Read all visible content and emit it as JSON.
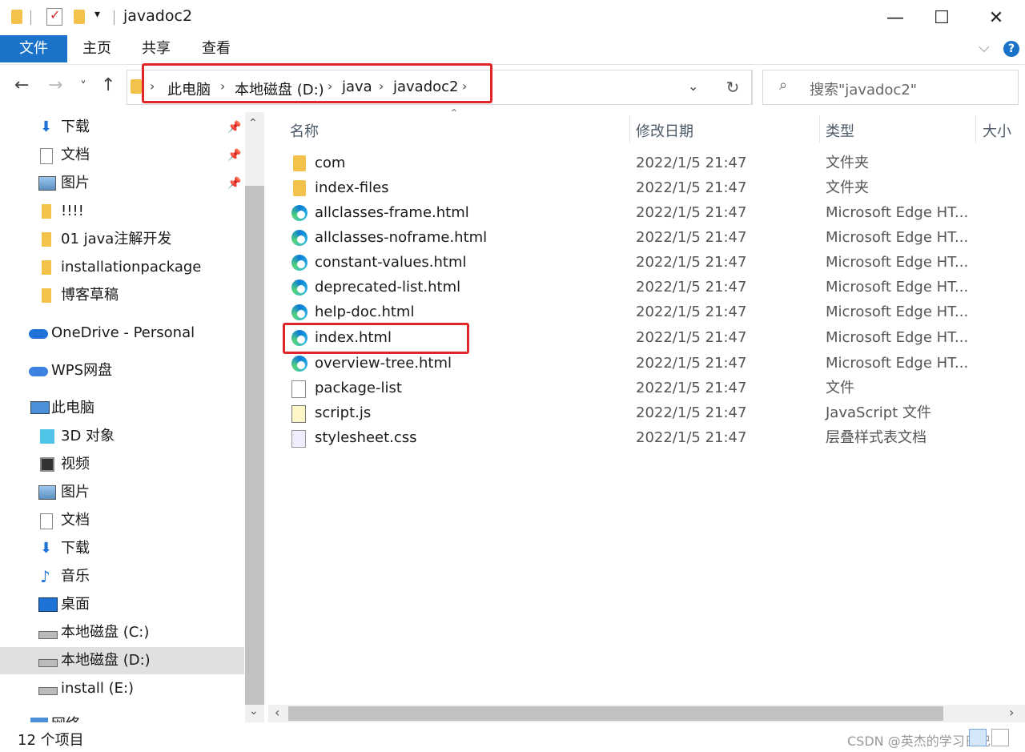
{
  "window": {
    "title": "javadoc2",
    "quick_access_dropdown": "▾",
    "minimize": "—",
    "maximize": "☐",
    "close": "✕"
  },
  "ribbon": {
    "tabs": [
      {
        "label": "文件"
      },
      {
        "label": "主页"
      },
      {
        "label": "共享"
      },
      {
        "label": "查看"
      }
    ],
    "expand_icon": "chevron-down-icon",
    "help": "?"
  },
  "nav": {
    "back": "←",
    "forward": "→",
    "recent": "˅",
    "up": "↑",
    "breadcrumb": [
      "此电脑",
      "本地磁盘 (D:)",
      "java",
      "javadoc2"
    ],
    "refresh": "↻",
    "search_placeholder": "搜索\"javadoc2\""
  },
  "sidebar": {
    "items": [
      {
        "label": "下载",
        "icon": "download-icon",
        "pinned": true
      },
      {
        "label": "文档",
        "icon": "document-icon",
        "pinned": true
      },
      {
        "label": "图片",
        "icon": "pictures-icon",
        "pinned": true
      },
      {
        "label": "!!!!",
        "icon": "folder-icon"
      },
      {
        "label": "01 java注解开发",
        "icon": "folder-icon"
      },
      {
        "label": "installationpackage",
        "icon": "folder-icon"
      },
      {
        "label": "博客草稿",
        "icon": "folder-icon"
      },
      {
        "label": "OneDrive - Personal",
        "icon": "onedrive-icon"
      },
      {
        "label": "WPS网盘",
        "icon": "cloud-icon"
      },
      {
        "label": "此电脑",
        "icon": "computer-icon"
      },
      {
        "label": "3D 对象",
        "icon": "3d-objects-icon"
      },
      {
        "label": "视频",
        "icon": "video-icon"
      },
      {
        "label": "图片",
        "icon": "pictures-icon"
      },
      {
        "label": "文档",
        "icon": "document-icon"
      },
      {
        "label": "下载",
        "icon": "download-icon"
      },
      {
        "label": "音乐",
        "icon": "music-icon"
      },
      {
        "label": "桌面",
        "icon": "desktop-icon"
      },
      {
        "label": "本地磁盘 (C:)",
        "icon": "drive-icon"
      },
      {
        "label": "本地磁盘 (D:)",
        "icon": "drive-icon",
        "selected": true
      },
      {
        "label": "install (E:)",
        "icon": "drive-icon"
      },
      {
        "label": "网络",
        "icon": "network-icon"
      }
    ]
  },
  "filelist": {
    "columns": {
      "name": "名称",
      "date": "修改日期",
      "type": "类型",
      "size": "大小"
    },
    "rows": [
      {
        "name": "com",
        "date": "2022/1/5 21:47",
        "type": "文件夹",
        "icon": "folder-icon"
      },
      {
        "name": "index-files",
        "date": "2022/1/5 21:47",
        "type": "文件夹",
        "icon": "folder-icon"
      },
      {
        "name": "allclasses-frame.html",
        "date": "2022/1/5 21:47",
        "type": "Microsoft Edge HT...",
        "icon": "edge-icon"
      },
      {
        "name": "allclasses-noframe.html",
        "date": "2022/1/5 21:47",
        "type": "Microsoft Edge HT...",
        "icon": "edge-icon"
      },
      {
        "name": "constant-values.html",
        "date": "2022/1/5 21:47",
        "type": "Microsoft Edge HT...",
        "icon": "edge-icon"
      },
      {
        "name": "deprecated-list.html",
        "date": "2022/1/5 21:47",
        "type": "Microsoft Edge HT...",
        "icon": "edge-icon"
      },
      {
        "name": "help-doc.html",
        "date": "2022/1/5 21:47",
        "type": "Microsoft Edge HT...",
        "icon": "edge-icon"
      },
      {
        "name": "index.html",
        "date": "2022/1/5 21:47",
        "type": "Microsoft Edge HT...",
        "icon": "edge-icon"
      },
      {
        "name": "overview-tree.html",
        "date": "2022/1/5 21:47",
        "type": "Microsoft Edge HT...",
        "icon": "edge-icon"
      },
      {
        "name": "package-list",
        "date": "2022/1/5 21:47",
        "type": "文件",
        "icon": "file-icon"
      },
      {
        "name": "script.js",
        "date": "2022/1/5 21:47",
        "type": "JavaScript 文件",
        "icon": "js-file-icon"
      },
      {
        "name": "stylesheet.css",
        "date": "2022/1/5 21:47",
        "type": "层叠样式表文档",
        "icon": "css-file-icon"
      }
    ]
  },
  "status": {
    "item_count": "12 个项目",
    "watermark": "CSDN @英杰的学习日记"
  },
  "colors": {
    "accent": "#1a73c9",
    "highlight": "#e0262b",
    "folder": "#f3c24d"
  }
}
